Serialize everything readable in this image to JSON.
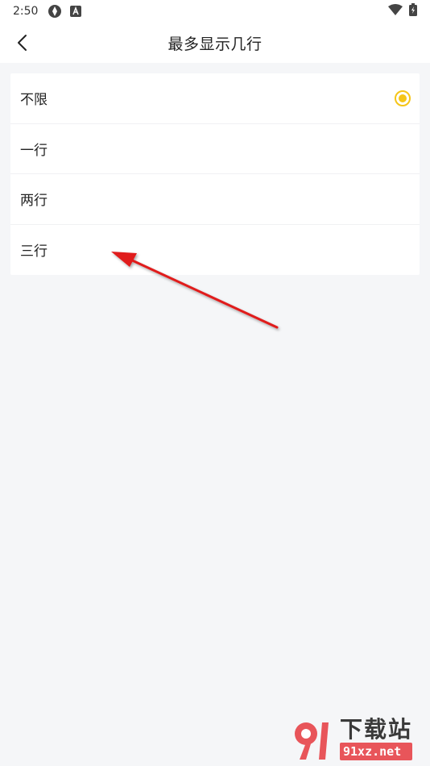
{
  "status_bar": {
    "time": "2:50",
    "icons": [
      "sync-icon",
      "a-badge-icon",
      "wifi-icon",
      "battery-charging-icon"
    ]
  },
  "app_bar": {
    "back_icon": "chevron-left-icon",
    "title": "最多显示几行"
  },
  "options": {
    "selected_index": 0,
    "accent_color": "#f5c518",
    "items": [
      {
        "label": "不限",
        "selected": true
      },
      {
        "label": "一行",
        "selected": false
      },
      {
        "label": "两行",
        "selected": false
      },
      {
        "label": "三行",
        "selected": false
      }
    ]
  },
  "annotation": {
    "type": "red-arrow",
    "color": "#e01b1b",
    "points_to": "三行"
  },
  "watermark": {
    "logo_icon": "91-logo-icon",
    "title": "下载站",
    "subtitle": "91xz.net"
  }
}
